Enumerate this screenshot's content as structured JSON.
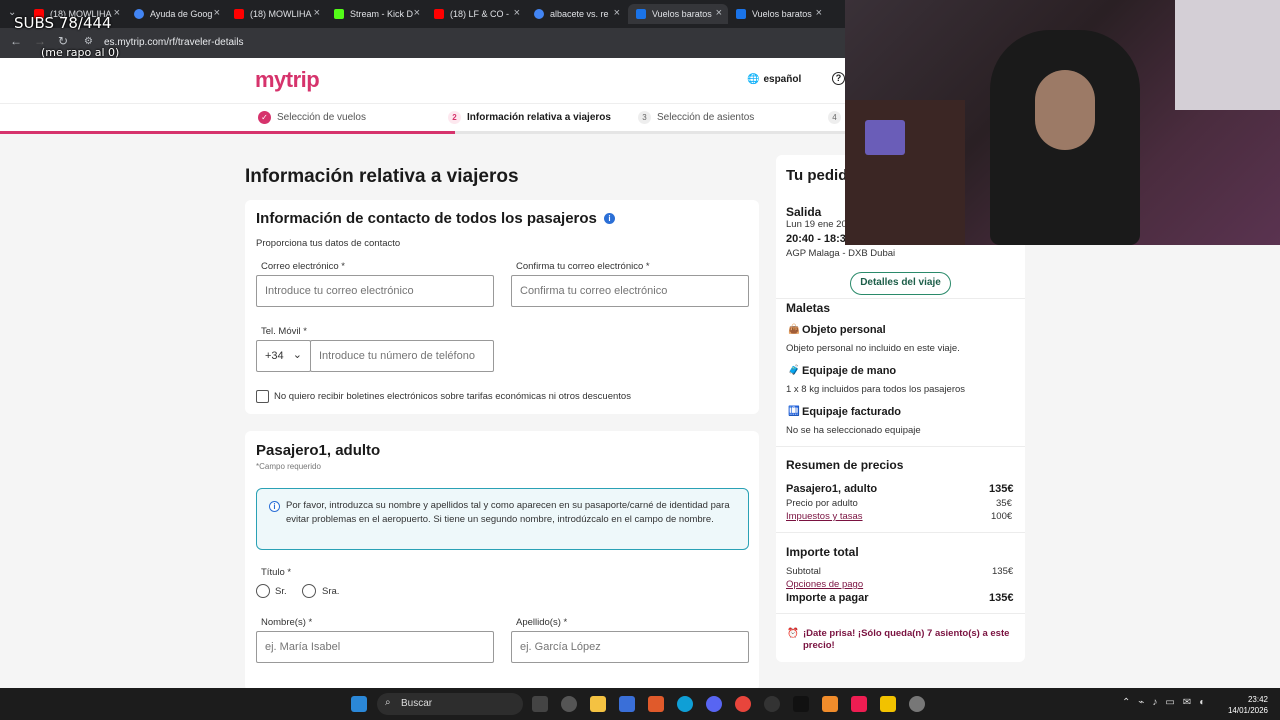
{
  "overlay": {
    "subs": "SUBS 78/444",
    "note": "(me rapo al 0)"
  },
  "browser": {
    "tabs": [
      {
        "title": "(18) MOWLIHA",
        "color": "#ff0000"
      },
      {
        "title": "Ayuda de Goog",
        "color": "#4285f4"
      },
      {
        "title": "(18) MOWLIHA",
        "color": "#ff0000"
      },
      {
        "title": "Stream - Kick D",
        "color": "#53fc18"
      },
      {
        "title": "(18) LF & CO -",
        "color": "#ff0000"
      },
      {
        "title": "albacete vs. re",
        "color": "#4285f4"
      },
      {
        "title": "Vuelos baratos",
        "color": "#1a73e8"
      },
      {
        "title": "Vuelos baratos",
        "color": "#1a73e8"
      }
    ],
    "url": "es.mytrip.com/rf/traveler-details"
  },
  "header": {
    "logo": "mytrip",
    "language": "español"
  },
  "steps": [
    {
      "num": "✓",
      "label": "Selección de vuelos",
      "state": "done"
    },
    {
      "num": "2",
      "label": "Información relativa a viajeros",
      "state": "current"
    },
    {
      "num": "3",
      "label": "Selección de asientos",
      "state": "pending"
    },
    {
      "num": "4",
      "label": "",
      "state": "pending"
    }
  ],
  "page_title": "Información relativa a viajeros",
  "contact": {
    "title": "Información de contacto de todos los pasajeros",
    "subtitle": "Proporciona tus datos de contacto",
    "email_label": "Correo electrónico *",
    "email_placeholder": "Introduce tu correo electrónico",
    "confirm_label": "Confirma tu correo electrónico *",
    "confirm_placeholder": "Confirma tu correo electrónico",
    "phone_label": "Tel. Móvil *",
    "country_code": "+34",
    "phone_placeholder": "Introduce tu número de teléfono",
    "newsletter_label": "No quiero recibir boletines electrónicos sobre tarifas económicas ni otros descuentos"
  },
  "passenger": {
    "title": "Pasajero1, adulto",
    "required_note": "*Campo requerido",
    "notice": "Por favor, introduzca su nombre y apellidos tal y como aparecen en su pasaporte/carné de identidad para evitar problemas en el aeropuerto. Si tiene un segundo nombre, introdúzcalo en el campo de nombre.",
    "title_label": "Título *",
    "option_mr": "Sr.",
    "option_mrs": "Sra.",
    "first_name_label": "Nombre(s) *",
    "first_name_placeholder": "ej. María Isabel",
    "last_name_label": "Apellido(s) *",
    "last_name_placeholder": "ej. García López"
  },
  "sidebar": {
    "title": "Tu pedido",
    "departure_label": "Salida",
    "date": "Lun 19 ene 20",
    "time": "20:40 - 18:3",
    "route": "AGP Malaga - DXB Dubai",
    "details_button": "Detalles del viaje",
    "luggage_title": "Maletas",
    "personal_title": "Objeto personal",
    "personal_text": "Objeto personal no incluido en este viaje.",
    "hand_title": "Equipaje de mano",
    "hand_text": "1 x 8 kg incluidos para todos los pasajeros",
    "checked_title": "Equipaje facturado",
    "checked_text": "No se ha seleccionado equipaje",
    "price_summary_title": "Resumen de precios",
    "passenger_line": "Pasajero1, adulto",
    "passenger_price": "135€",
    "adult_price_label": "Precio por adulto",
    "adult_price": "35€",
    "taxes_label": "Impuestos y tasas",
    "taxes": "100€",
    "total_title": "Importe total",
    "subtotal_label": "Subtotal",
    "subtotal": "135€",
    "payment_options": "Opciones de pago",
    "to_pay_label": "Importe a pagar",
    "to_pay": "135€",
    "hurry_text": "¡Date prisa! ¡Sólo queda(n) 7 asiento(s) a este precio!"
  },
  "taskbar": {
    "search_label": "Buscar",
    "time": "23:42",
    "date": "14/01/2026"
  }
}
